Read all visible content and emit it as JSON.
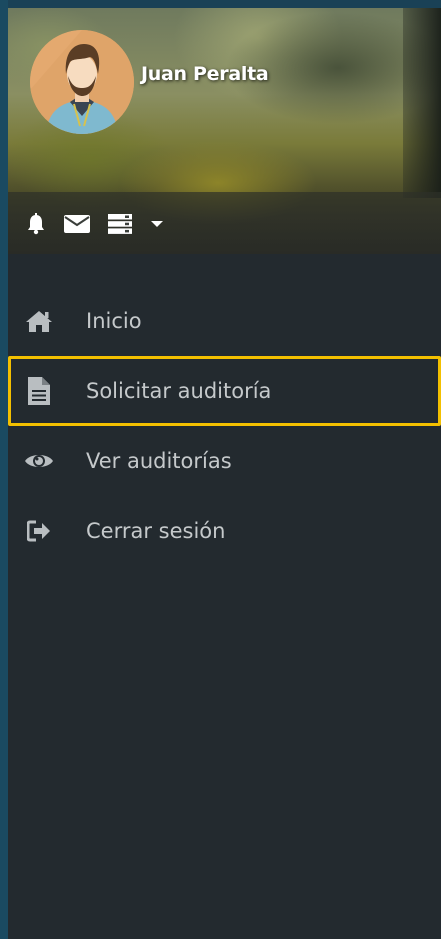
{
  "user": {
    "name": "Juan Peralta"
  },
  "toolbar": {
    "icons": [
      "bell-icon",
      "envelope-icon",
      "server-icon",
      "caret-down-icon"
    ]
  },
  "menu": {
    "items": [
      {
        "label": "Inicio",
        "icon": "home-icon"
      },
      {
        "label": "Solicitar auditoría",
        "icon": "file-icon",
        "active": true
      },
      {
        "label": "Ver auditorías",
        "icon": "eye-icon"
      },
      {
        "label": "Cerrar sesión",
        "icon": "sign-out-icon"
      }
    ]
  },
  "colors": {
    "sidebar_bg": "#232a2f",
    "frame_bg": "#1a4156",
    "active_border": "#f3c000",
    "menu_text": "#c5c9cb",
    "icon_color": "#b9bec1"
  }
}
